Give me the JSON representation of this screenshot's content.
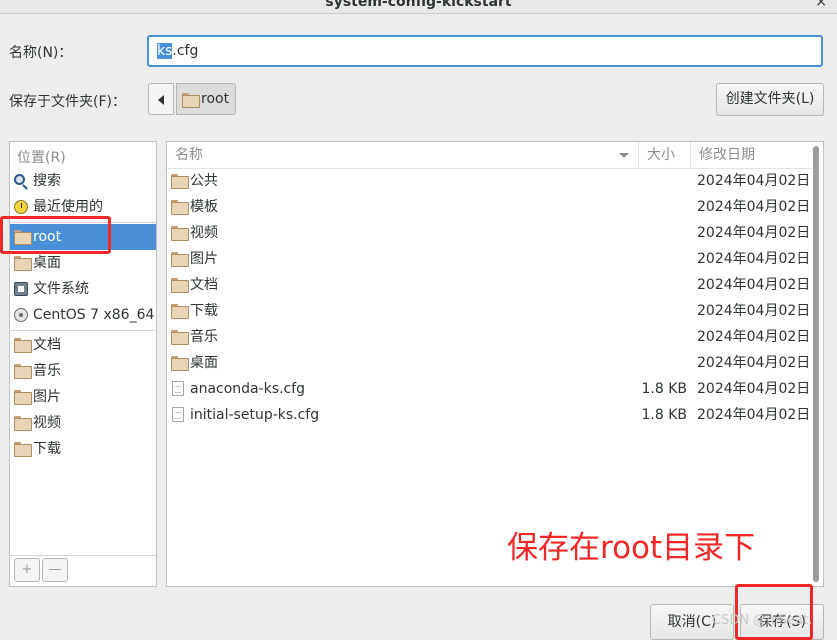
{
  "window": {
    "title": "system-config-kickstart",
    "close_label": "×"
  },
  "name_field": {
    "label": "名称(N)：",
    "value_selected": "ks",
    "value_rest": ".cfg"
  },
  "folder_field": {
    "label": "保存于文件夹(F)：",
    "current": "root"
  },
  "toolbar": {
    "create_folder_label": "创建文件夹(L)"
  },
  "sidebar": {
    "header": "位置(R)",
    "items": [
      {
        "label": "搜索",
        "icon": "search-icon"
      },
      {
        "label": "最近使用的",
        "icon": "clock-icon"
      },
      {
        "label": "root",
        "icon": "home-folder-icon",
        "active": true
      },
      {
        "label": "桌面",
        "icon": "desktop-folder-icon"
      },
      {
        "label": "文件系统",
        "icon": "drive-icon"
      },
      {
        "label": "CentOS 7 x86_64",
        "icon": "disc-icon"
      },
      {
        "label": "文档",
        "icon": "documents-folder-icon"
      },
      {
        "label": "音乐",
        "icon": "music-folder-icon"
      },
      {
        "label": "图片",
        "icon": "pictures-folder-icon"
      },
      {
        "label": "视频",
        "icon": "videos-folder-icon"
      },
      {
        "label": "下载",
        "icon": "downloads-folder-icon"
      }
    ],
    "add_label": "+",
    "remove_label": "—"
  },
  "file_list": {
    "columns": {
      "name": "名称",
      "size": "大小",
      "date": "修改日期"
    },
    "rows": [
      {
        "name": "公共",
        "size": "",
        "date": "2024年04月02日",
        "type": "folder"
      },
      {
        "name": "模板",
        "size": "",
        "date": "2024年04月02日",
        "type": "folder"
      },
      {
        "name": "视频",
        "size": "",
        "date": "2024年04月02日",
        "type": "folder"
      },
      {
        "name": "图片",
        "size": "",
        "date": "2024年04月02日",
        "type": "folder"
      },
      {
        "name": "文档",
        "size": "",
        "date": "2024年04月02日",
        "type": "folder"
      },
      {
        "name": "下载",
        "size": "",
        "date": "2024年04月02日",
        "type": "folder"
      },
      {
        "name": "音乐",
        "size": "",
        "date": "2024年04月02日",
        "type": "folder"
      },
      {
        "name": "桌面",
        "size": "",
        "date": "2024年04月02日",
        "type": "folder"
      },
      {
        "name": "anaconda-ks.cfg",
        "size": "1.8 KB",
        "date": "2024年04月02日",
        "type": "file"
      },
      {
        "name": "initial-setup-ks.cfg",
        "size": "1.8 KB",
        "date": "2024年04月02日",
        "type": "file"
      }
    ]
  },
  "annotation": {
    "text": "保存在root目录下",
    "color": "#f22727"
  },
  "buttons": {
    "cancel": "取消(C)",
    "save": "保存(S)"
  },
  "watermark": "CSDN @mSeat."
}
